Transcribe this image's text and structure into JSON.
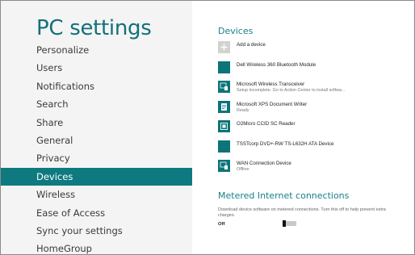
{
  "header": {
    "title": "PC settings"
  },
  "sidebar": {
    "items": [
      {
        "label": "Personalize"
      },
      {
        "label": "Users"
      },
      {
        "label": "Notifications"
      },
      {
        "label": "Search"
      },
      {
        "label": "Share"
      },
      {
        "label": "General"
      },
      {
        "label": "Privacy"
      },
      {
        "label": "Devices",
        "active": true
      },
      {
        "label": "Wireless"
      },
      {
        "label": "Ease of Access"
      },
      {
        "label": "Sync your settings"
      },
      {
        "label": "HomeGroup"
      }
    ]
  },
  "devices": {
    "title": "Devices",
    "items": [
      {
        "name": "Add a device",
        "status": "",
        "icon": "plus-icon"
      },
      {
        "name": "Dell Wireless 360 Bluetooth Module",
        "status": "",
        "icon": "device-icon"
      },
      {
        "name": "Microsoft Wireless Transceiver",
        "status": "Setup incomplete. Go to Action Center to install softwa...",
        "icon": "device-icon"
      },
      {
        "name": "Microsoft XPS Document Writer",
        "status": "Ready",
        "icon": "printer-icon"
      },
      {
        "name": "O2Micro CCID SC Reader",
        "status": "",
        "icon": "device-icon"
      },
      {
        "name": "TSSTcorp DVD+-RW TS-L632H ATA Device",
        "status": "",
        "icon": "drive-icon"
      },
      {
        "name": "WAN Connection Device",
        "status": "Offline",
        "icon": "device-icon"
      }
    ]
  },
  "metered": {
    "title": "Metered Internet connections",
    "description": "Download device software on metered connections. Turn this off to help prevent extra charges.",
    "toggle_label": "Off",
    "toggle_on": false
  },
  "colors": {
    "accent": "#0e7a80",
    "tile": "#0d7479",
    "sidebar_bg": "#f4f4f4"
  }
}
